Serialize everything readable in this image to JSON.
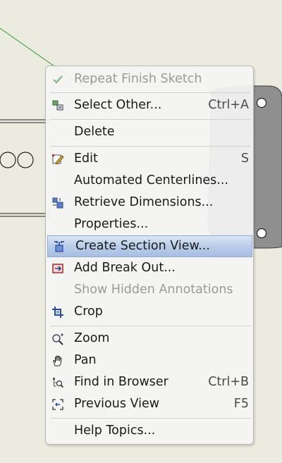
{
  "menu": {
    "items": [
      {
        "label": "Repeat Finish Sketch",
        "shortcut": "",
        "icon": "check-icon",
        "disabled": true
      },
      {
        "label": "Select Other...",
        "shortcut": "Ctrl+A",
        "icon": "select-other-icon"
      },
      {
        "label": "Delete",
        "shortcut": ""
      },
      {
        "label": "Edit",
        "shortcut": "S",
        "icon": "edit-icon"
      },
      {
        "label": "Automated Centerlines...",
        "shortcut": ""
      },
      {
        "label": "Retrieve Dimensions...",
        "shortcut": "",
        "icon": "retrieve-dimensions-icon"
      },
      {
        "label": "Properties...",
        "shortcut": ""
      },
      {
        "label": "Create Section View...",
        "shortcut": "",
        "icon": "section-view-icon",
        "highlighted": true
      },
      {
        "label": "Add Break Out...",
        "shortcut": "",
        "icon": "break-out-icon"
      },
      {
        "label": "Show Hidden Annotations",
        "shortcut": "",
        "disabled": true
      },
      {
        "label": "Crop",
        "shortcut": "",
        "icon": "crop-icon"
      },
      {
        "label": "Zoom",
        "shortcut": "",
        "icon": "zoom-icon"
      },
      {
        "label": "Pan",
        "shortcut": "",
        "icon": "pan-hand-icon"
      },
      {
        "label": "Find in Browser",
        "shortcut": "Ctrl+B",
        "icon": "find-in-browser-icon"
      },
      {
        "label": "Previous View",
        "shortcut": "F5",
        "icon": "previous-view-icon"
      },
      {
        "label": "Help Topics...",
        "shortcut": ""
      }
    ]
  },
  "colors": {
    "background": "#ecebe0",
    "highlight": "#b9cde9",
    "canvas_line_green": "#2a9a2a",
    "part_fill": "#8f8f8f"
  }
}
